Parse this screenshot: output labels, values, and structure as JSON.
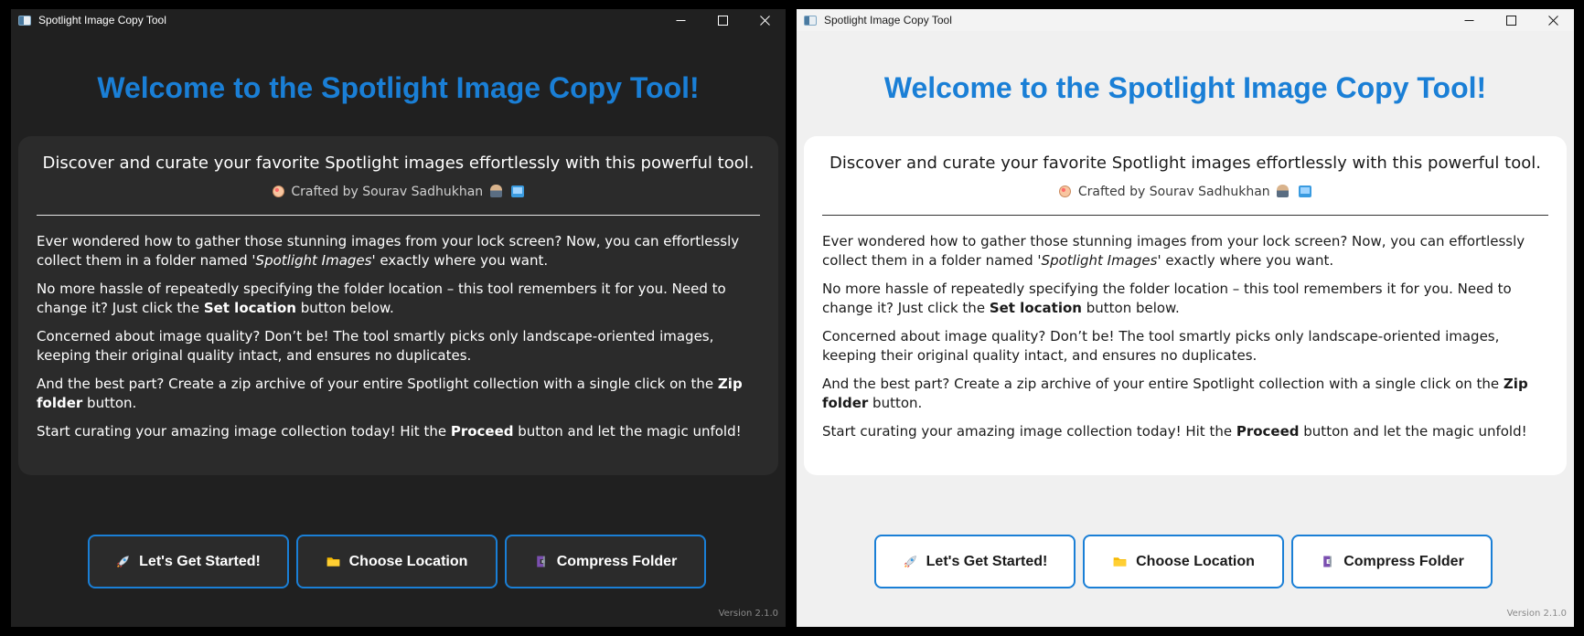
{
  "window_title": "Spotlight Image Copy Tool",
  "heading": "Welcome to the Spotlight Image Copy Tool!",
  "tagline": "Discover and curate your favorite Spotlight images effortlessly with this powerful tool.",
  "credit": "Crafted by Sourav Sadhukhan",
  "paragraphs": {
    "p1_a": "Ever wondered how to gather those stunning images from your lock screen? Now, you can effortlessly collect them in a folder named '",
    "p1_em": "Spotlight Images",
    "p1_b": "' exactly where you want.",
    "p2_a": "No more hassle of repeatedly specifying the folder location – this tool remembers it for you. Need to change it? Just click the ",
    "p2_strong": "Set location",
    "p2_b": " button below.",
    "p3": "Concerned about image quality? Don’t be! The tool smartly picks only landscape-oriented images, keeping their original quality intact, and ensures no duplicates.",
    "p4_a": "And the best part? Create a zip archive of your entire Spotlight collection with a single click on the ",
    "p4_strong": "Zip folder",
    "p4_b": " button.",
    "p5_a": "Start curating your amazing image collection today! Hit the ",
    "p5_strong": "Proceed",
    "p5_b": " button and let the magic unfold!"
  },
  "buttons": {
    "start": "Let's Get Started!",
    "location": "Choose Location",
    "compress": "Compress Folder"
  },
  "version": "Version 2.1.0",
  "icons": {
    "credit": [
      "palette-icon",
      "technologist-icon",
      "computer-icon"
    ],
    "start": "rocket-icon",
    "location": "folder-icon",
    "compress": "clamp-icon"
  },
  "colors": {
    "accent": "#1a7fd6",
    "dark_bg": "#202020",
    "dark_card": "#2b2b2b",
    "light_bg": "#f0f0f0",
    "light_card": "#ffffff"
  }
}
